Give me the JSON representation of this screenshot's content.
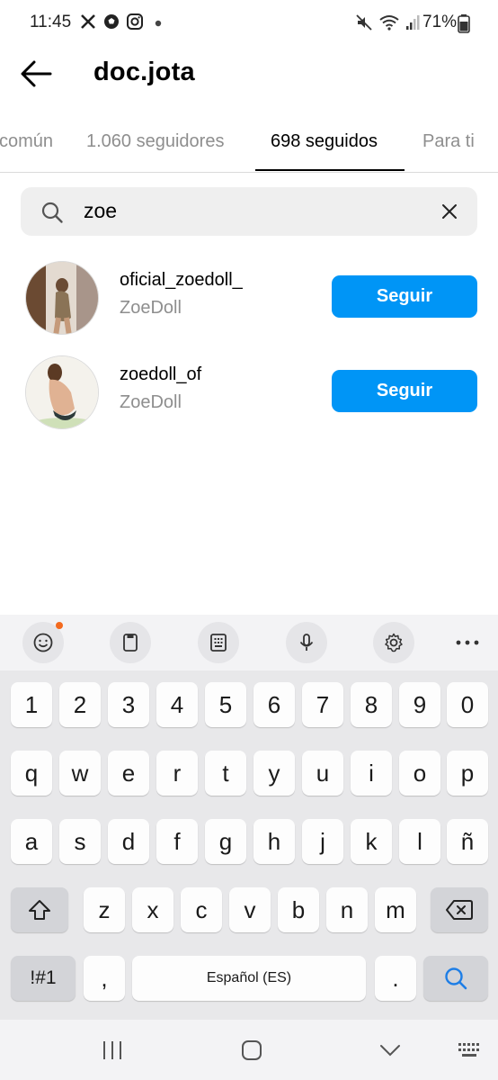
{
  "status_bar": {
    "time": "11:45",
    "battery": "71%",
    "left_icons": [
      "x-icon",
      "soccer-ball-icon",
      "instagram-icon",
      "dot-icon"
    ],
    "right_icons": [
      "mute-icon",
      "wifi-icon",
      "signal-icon",
      "battery-icon"
    ]
  },
  "header": {
    "title": "doc.jota"
  },
  "tabs": [
    {
      "label": "común",
      "active": false
    },
    {
      "label": "1.060 seguidores",
      "active": false
    },
    {
      "label": "698 seguidos",
      "active": true
    },
    {
      "label": "Para ti",
      "active": false
    }
  ],
  "search": {
    "value": "zoe"
  },
  "results": [
    {
      "username": "oficial_zoedoll_",
      "display_name": "ZoeDoll",
      "button": "Seguir"
    },
    {
      "username": "zoedoll_of",
      "display_name": "ZoeDoll",
      "button": "Seguir"
    }
  ],
  "keyboard": {
    "row_numbers": [
      "1",
      "2",
      "3",
      "4",
      "5",
      "6",
      "7",
      "8",
      "9",
      "0"
    ],
    "row1": [
      "q",
      "w",
      "e",
      "r",
      "t",
      "y",
      "u",
      "i",
      "o",
      "p"
    ],
    "row2": [
      "a",
      "s",
      "d",
      "f",
      "g",
      "h",
      "j",
      "k",
      "l",
      "ñ"
    ],
    "row3": [
      "z",
      "x",
      "c",
      "v",
      "b",
      "n",
      "m"
    ],
    "symbols_key": "!#1",
    "comma_key": ",",
    "space_key": "Español (ES)",
    "period_key": "."
  },
  "colors": {
    "accent": "#0095f6",
    "muted": "#8e8e8e",
    "notification_dot": "#f36a1f"
  }
}
